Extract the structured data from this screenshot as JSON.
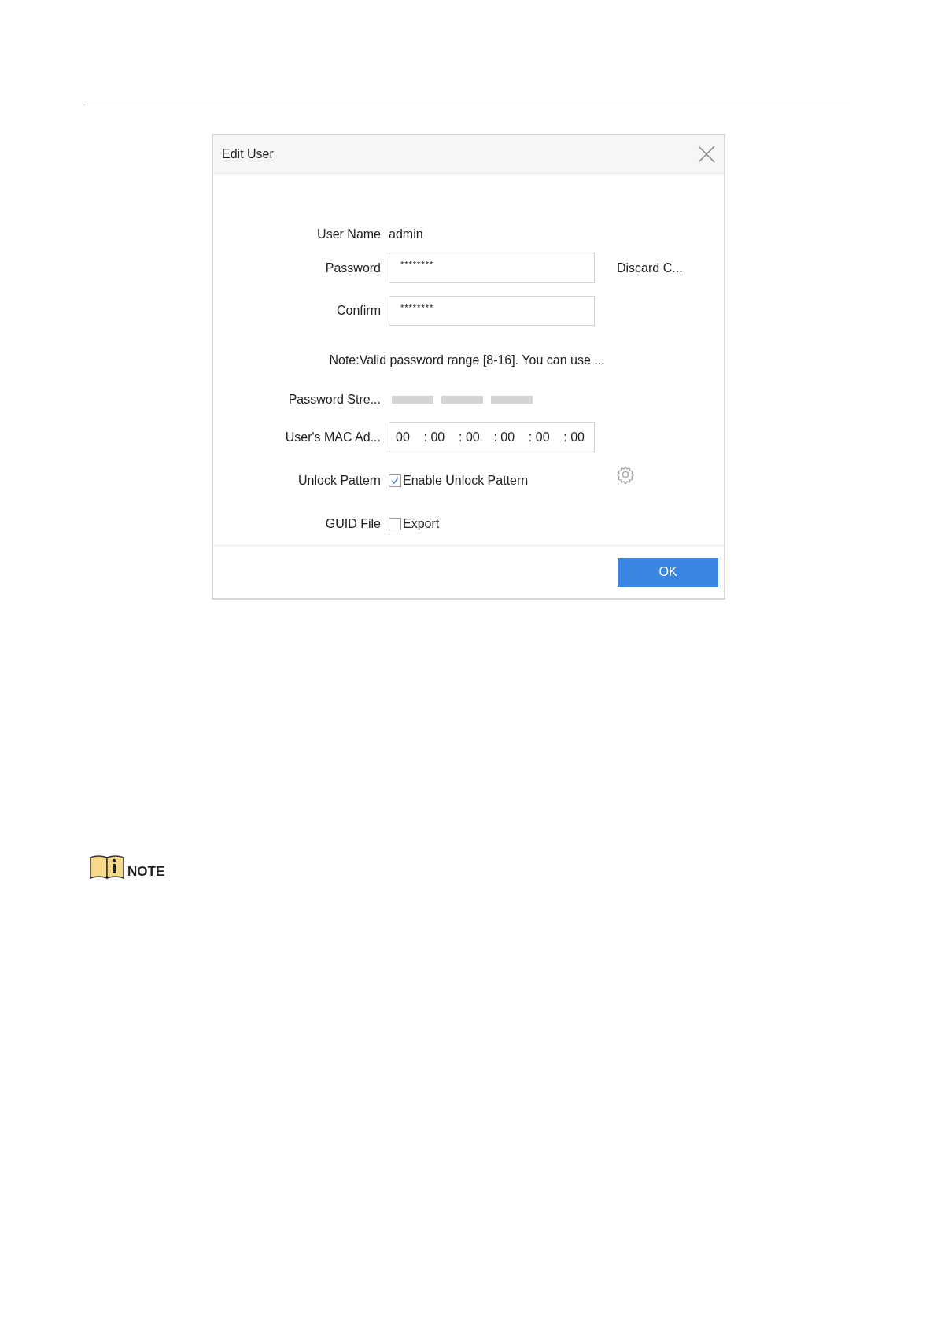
{
  "dialog": {
    "title": "Edit User",
    "user_name": {
      "label": "User Name",
      "value": "admin"
    },
    "password": {
      "label": "Password",
      "value": "********",
      "action": "Discard C..."
    },
    "confirm": {
      "label": "Confirm",
      "value": "********"
    },
    "note": "Note:Valid password range [8-16]. You can use ...",
    "strength": {
      "label": "Password Stre...",
      "segments": [
        {
          "lit": false
        },
        {
          "lit": false
        },
        {
          "lit": false
        }
      ]
    },
    "mac": {
      "label": "User's MAC Ad...",
      "parts": [
        "00",
        ": 00",
        ": 00",
        ": 00",
        ": 00",
        ": 00"
      ]
    },
    "unlock_pattern": {
      "label": "Unlock Pattern",
      "option": "Enable Unlock Pattern",
      "checked": true
    },
    "guid_file": {
      "label": "GUID File",
      "option": "Export",
      "checked": false
    },
    "buttons": [
      "OK"
    ]
  },
  "note_heading": "NOTE"
}
